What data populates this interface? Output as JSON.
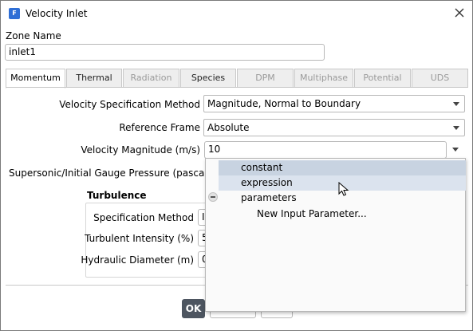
{
  "window": {
    "title": "Velocity Inlet",
    "app_icon_letter": "F"
  },
  "zone": {
    "label": "Zone Name",
    "value": "inlet1"
  },
  "tabs": [
    {
      "label": "Momentum",
      "state": "active"
    },
    {
      "label": "Thermal",
      "state": "enabled"
    },
    {
      "label": "Radiation",
      "state": "disabled"
    },
    {
      "label": "Species",
      "state": "enabled"
    },
    {
      "label": "DPM",
      "state": "disabled"
    },
    {
      "label": "Multiphase",
      "state": "disabled"
    },
    {
      "label": "Potential",
      "state": "disabled"
    },
    {
      "label": "UDS",
      "state": "disabled"
    }
  ],
  "momentum": {
    "velocity_spec_label": "Velocity Specification Method",
    "velocity_spec_value": "Magnitude, Normal to Boundary",
    "reference_frame_label": "Reference Frame",
    "reference_frame_value": "Absolute",
    "velocity_magnitude_label": "Velocity Magnitude (m/s)",
    "velocity_magnitude_value": "10",
    "supersonic_label": "Supersonic/Initial Gauge Pressure (pascal)"
  },
  "turbulence": {
    "heading": "Turbulence",
    "spec_method_label": "Specification Method",
    "spec_method_value": "I",
    "intensity_label": "Turbulent Intensity (%)",
    "intensity_value": "5",
    "diameter_label": "Hydraulic Diameter (m)",
    "diameter_value": "0"
  },
  "buttons": {
    "ok": "OK"
  },
  "dropdown": {
    "items": [
      {
        "label": "constant"
      },
      {
        "label": "expression"
      },
      {
        "label": "parameters"
      },
      {
        "label": "New Input Parameter..."
      }
    ]
  },
  "colors": {
    "highlight_primary": "#c8d3e1",
    "highlight_hover": "#dbe3ee",
    "ok_button": "#4d5560",
    "app_icon": "#2f6fd6"
  }
}
